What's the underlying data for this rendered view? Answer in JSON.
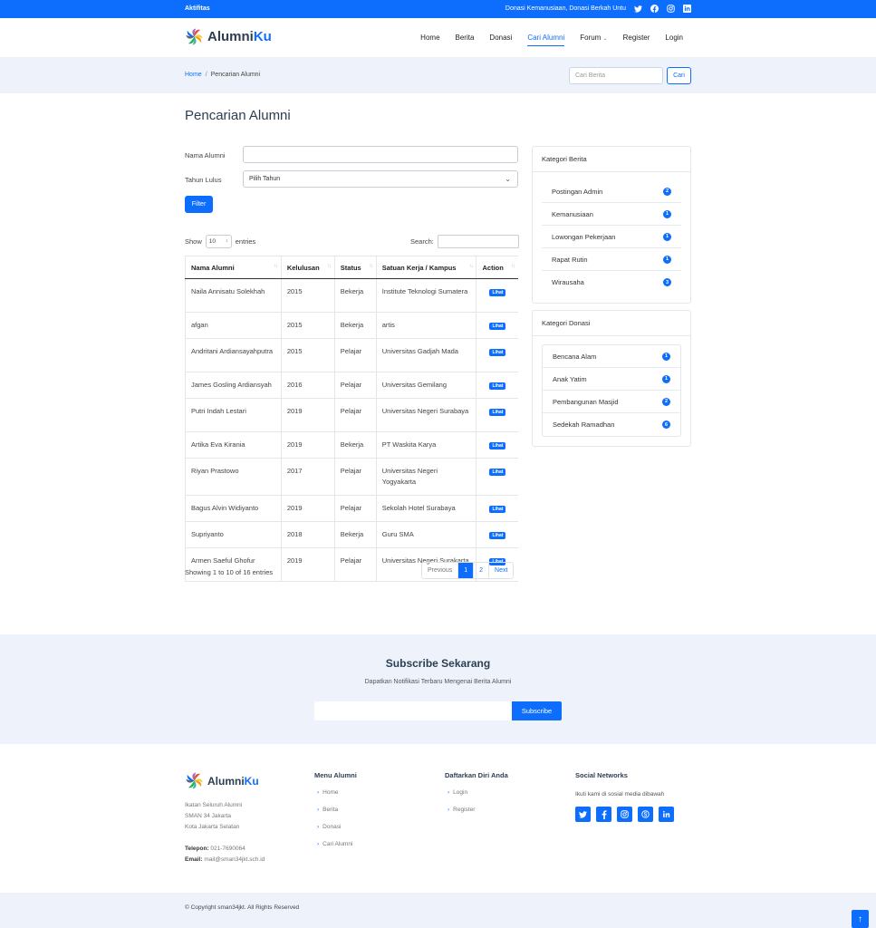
{
  "topbar": {
    "left": "Aktifitas",
    "right": "Donasi Kemanusiaan, Donasi Berkah Untu",
    "icons": [
      "twitter-icon",
      "facebook-icon",
      "instagram-icon",
      "linkedin-icon"
    ]
  },
  "brand": {
    "name_a": "Alumni",
    "name_b": "Ku",
    "accent": "#0d6efd"
  },
  "nav": {
    "items": [
      "Home",
      "Berita",
      "Donasi",
      "Cari Alumni",
      "Forum",
      "Register",
      "Login"
    ],
    "active": "Cari Alumni"
  },
  "breadcrumb": {
    "home": "Home",
    "sep": "/",
    "current": "Pencarian Alumni"
  },
  "news_search": {
    "placeholder": "Cari Berita",
    "button": "Cari"
  },
  "page_title": "Pencarian Alumni",
  "form": {
    "nama_label": "Nama Alumni",
    "nama_value": "",
    "tahun_label": "Tahun Lulus",
    "tahun_value": "Pilih Tahun",
    "filter_button": "Filter"
  },
  "datatable": {
    "show": "Show",
    "length": "10",
    "entries": "entries",
    "search_label": "Search:",
    "columns": [
      "Nama Alumni",
      "Kelulusan",
      "Status",
      "Satuan Kerja / Kampus",
      "Action"
    ],
    "rows": [
      [
        "Naila Annisatu Solekhah",
        "2015",
        "Bekerja",
        "Institute Teknologi Sumatera",
        "Lihat"
      ],
      [
        "afgan",
        "2015",
        "Bekerja",
        "artis",
        "Lihat"
      ],
      [
        "Andritani Ardiansayahputra",
        "2015",
        "Pelajar",
        "Universitas Gadjah Mada",
        "Lihat"
      ],
      [
        "James Gosling Ardiansyah",
        "2016",
        "Pelajar",
        "Universitas Gemilang",
        "Lihat"
      ],
      [
        "Putri Indah Lestari",
        "2019",
        "Pelajar",
        "Universitas Negeri Surabaya",
        "Lihat"
      ],
      [
        "Artika Eva Kirania",
        "2019",
        "Bekerja",
        "PT Waskita Karya",
        "Lihat"
      ],
      [
        "Riyan Prastowo",
        "2017",
        "Pelajar",
        "Universitas Negeri Yogyakarta",
        "Lihat"
      ],
      [
        "Bagus Alvin Widiyanto",
        "2019",
        "Pelajar",
        "Sekolah Hotel Surabaya",
        "Lihat"
      ],
      [
        "Supriyanto",
        "2018",
        "Bekerja",
        "Guru SMA",
        "Lihat"
      ],
      [
        "Armen Saeful Ghofur",
        "2019",
        "Pelajar",
        "Universitas Negeri Surakarta",
        "Lihat"
      ]
    ],
    "info": "Showing 1 to 10 of 16 entries",
    "pager": [
      "Previous",
      "1",
      "2",
      "Next"
    ],
    "current_page": "1"
  },
  "sidebar": {
    "berita": {
      "title": "Kategori Berita",
      "items": [
        {
          "label": "Postingan Admin",
          "count": "2"
        },
        {
          "label": "Kemanusiaan",
          "count": "1"
        },
        {
          "label": "Lowongan Pekerjaan",
          "count": "1"
        },
        {
          "label": "Rapat Rutin",
          "count": "1"
        },
        {
          "label": "Wirausaha",
          "count": "3"
        }
      ]
    },
    "donasi": {
      "title": "Kategori Donasi",
      "items": [
        {
          "label": "Bencana Alam",
          "count": "1"
        },
        {
          "label": "Anak Yatim",
          "count": "1"
        },
        {
          "label": "Pembangunan Masjid",
          "count": "2"
        },
        {
          "label": "Sedekah Ramadhan",
          "count": "6"
        }
      ]
    }
  },
  "subscribe": {
    "title": "Subscribe Sekarang",
    "desc": "Dapatkan Notifikasi Terbaru Mengenai Berita Alumni",
    "button": "Subscribe"
  },
  "footer": {
    "address": [
      "Ikatan Seluruh Alumni",
      "SMAN 34 Jakarta",
      "Kota Jakarta Selatan"
    ],
    "phone_label": "Telepon:",
    "phone": "021-7690064",
    "email_label": "Email:",
    "email": "mail@sman34jkt.sch.id",
    "menu_title": "Menu Alumni",
    "menu": [
      "Home",
      "Berita",
      "Donasi",
      "Cari Alumni"
    ],
    "daftar_title": "Daftarkan Diri Anda",
    "daftar": [
      "Login",
      "Register"
    ],
    "social_title": "Social Networks",
    "social_desc": "Ikuti kami di sosial media dibawah",
    "social_icons": [
      "twitter-icon",
      "facebook-icon",
      "instagram-icon",
      "skype-icon",
      "linkedin-icon"
    ]
  },
  "copyright": "© Copyright sman34jkt. All Rights Reserved"
}
